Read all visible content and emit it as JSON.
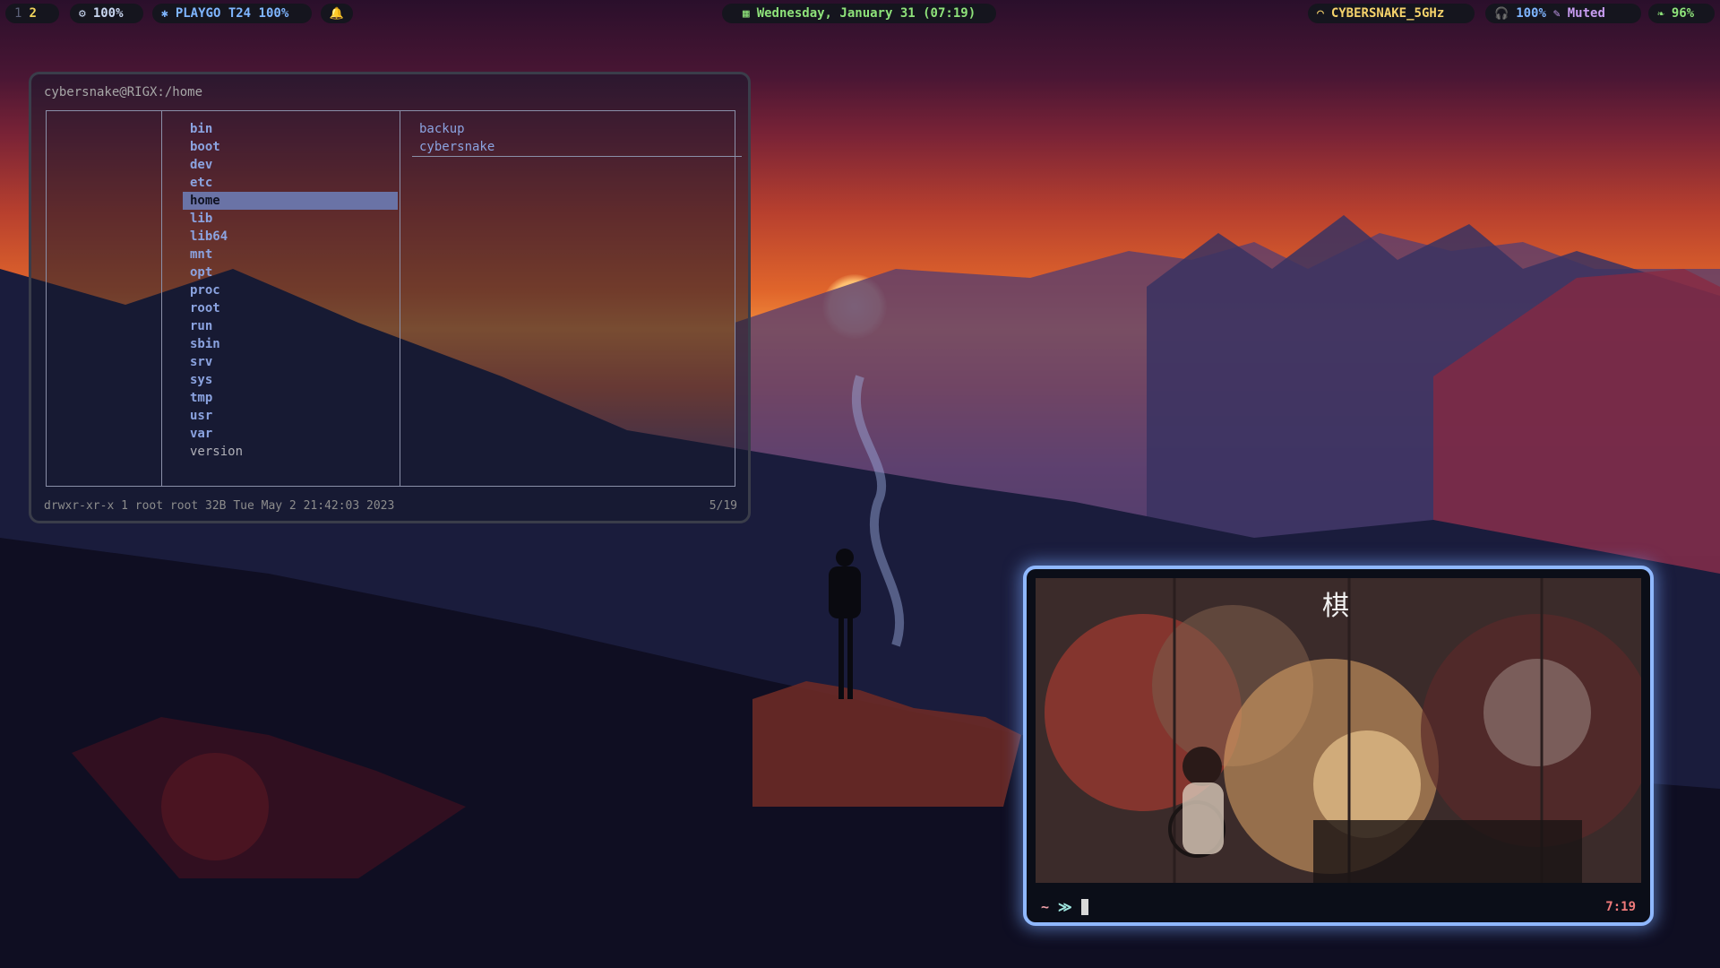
{
  "topbar": {
    "workspaces": [
      "1",
      "2"
    ],
    "active_workspace": "2",
    "cpu": {
      "icon": "gear-icon",
      "value": "100%"
    },
    "bluetooth": {
      "icon": "bluetooth-icon",
      "label": "PLAYGO T24 100%"
    },
    "notification_icon": "bell-icon",
    "clock": {
      "icon": "calendar-icon",
      "text": "Wednesday, January 31 (07:19)"
    },
    "wifi": {
      "icon": "wifi-icon",
      "ssid": "CYBERSNAKE_5GHz"
    },
    "headphones": {
      "icon": "headphones-icon",
      "value": "100%"
    },
    "mic": {
      "icon": "mic-muted-icon",
      "label": "Muted"
    },
    "battery": {
      "icon": "battery-leaf-icon",
      "value": "96%"
    }
  },
  "file_manager": {
    "title": "cybersnake@RIGX:/home",
    "entries": [
      {
        "name": "bin",
        "kind": "dir"
      },
      {
        "name": "boot",
        "kind": "dir"
      },
      {
        "name": "dev",
        "kind": "dir"
      },
      {
        "name": "etc",
        "kind": "dir"
      },
      {
        "name": "home",
        "kind": "dir",
        "selected": true
      },
      {
        "name": "lib",
        "kind": "dir"
      },
      {
        "name": "lib64",
        "kind": "dir"
      },
      {
        "name": "mnt",
        "kind": "dir"
      },
      {
        "name": "opt",
        "kind": "dir"
      },
      {
        "name": "proc",
        "kind": "dir"
      },
      {
        "name": "root",
        "kind": "dir"
      },
      {
        "name": "run",
        "kind": "dir"
      },
      {
        "name": "sbin",
        "kind": "dir"
      },
      {
        "name": "srv",
        "kind": "dir"
      },
      {
        "name": "sys",
        "kind": "dir"
      },
      {
        "name": "tmp",
        "kind": "dir"
      },
      {
        "name": "usr",
        "kind": "dir"
      },
      {
        "name": "var",
        "kind": "dir"
      },
      {
        "name": "version",
        "kind": "file"
      }
    ],
    "preview_entries": [
      "backup",
      "cybersnake"
    ],
    "status": "drwxr-xr-x 1 root root 32B Tue May  2 21:42:03 2023",
    "position": "5/19"
  },
  "terminal": {
    "art_glyph": "棋",
    "prompt_tilde": "~",
    "prompt_arrow": "≫",
    "time": "7:19"
  },
  "colors": {
    "workspace_active": "#f2d45c",
    "bar_background": "#15151e",
    "fm_selected": "#6a73a6",
    "terminal_border": "#8fb8ff",
    "terminal_time": "#f07a7a"
  }
}
